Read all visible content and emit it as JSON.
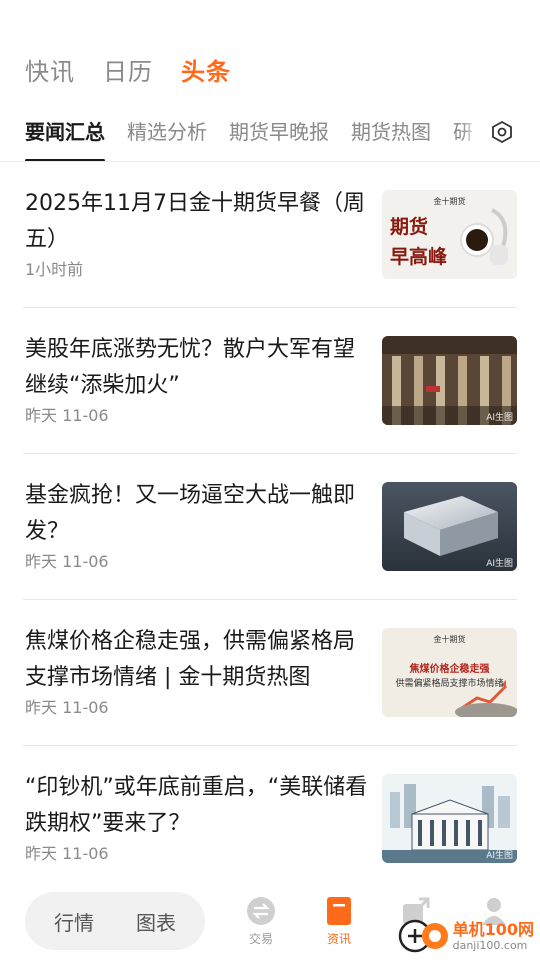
{
  "top_tabs": [
    {
      "label": "快讯"
    },
    {
      "label": "日历"
    },
    {
      "label": "头条"
    }
  ],
  "sub_tabs": [
    {
      "label": "要闻汇总"
    },
    {
      "label": "精选分析"
    },
    {
      "label": "期货早晚报"
    },
    {
      "label": "期货热图"
    },
    {
      "label": "研"
    }
  ],
  "news": [
    {
      "title": "2025年11月7日金十期货早餐（周五）",
      "time": "1小时前",
      "thumb": {
        "brand": "金十期货",
        "line1": "期货",
        "line2": "早高峰"
      }
    },
    {
      "title": "美股年底涨势无忧？散户大军有望继续“添柴加火”",
      "time": "昨天 11-06",
      "thumb": {
        "ai_tag": "AI生图"
      }
    },
    {
      "title": "基金疯抢！又一场逼空大战一触即发？",
      "time": "昨天 11-06",
      "thumb": {
        "ai_tag": "AI生图"
      }
    },
    {
      "title": "焦煤价格企稳走强，供需偏紧格局支撑市场情绪 | 金十期货热图",
      "time": "昨天 11-06",
      "thumb": {
        "brand": "金十期货",
        "line1": "焦煤价格企稳走强",
        "line2": "供需偏紧格局支撑市场情绪"
      }
    },
    {
      "title": "“印钞机”或年底前重启，“美联储看跌期权”要来了？",
      "time": "昨天 11-06",
      "thumb": {
        "ai_tag": "AI生图"
      }
    }
  ],
  "bottom_nav": {
    "pill": [
      "行情",
      "图表"
    ],
    "items": [
      {
        "label": "交易"
      },
      {
        "label": "资讯"
      },
      {
        "label": ""
      },
      {
        "label": ""
      }
    ]
  },
  "watermark": {
    "title": "单机100网",
    "url": "danji100.com"
  },
  "colors": {
    "accent": "#ff6a1a",
    "text": "#1a1a1a",
    "muted": "#8a8a8a"
  }
}
